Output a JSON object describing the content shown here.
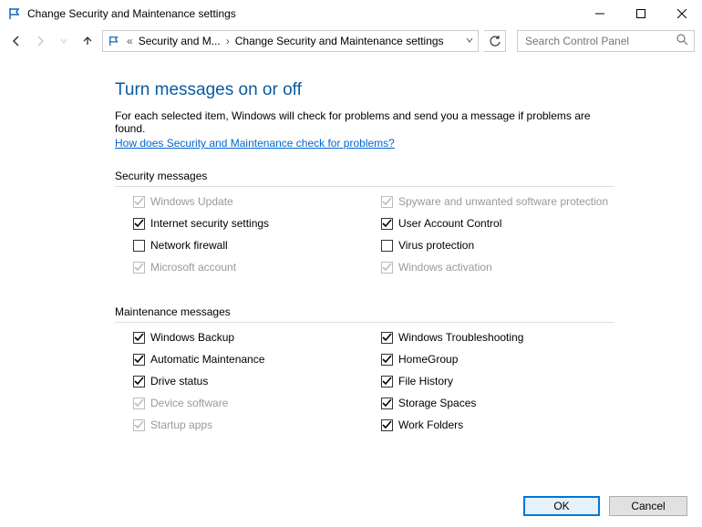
{
  "window": {
    "title": "Change Security and Maintenance settings"
  },
  "breadcrumb": {
    "item1": "Security and M...",
    "item2": "Change Security and Maintenance settings"
  },
  "search": {
    "placeholder": "Search Control Panel"
  },
  "page": {
    "title": "Turn messages on or off",
    "desc": "For each selected item, Windows will check for problems and send you a message if problems are found.",
    "help": "How does Security and Maintenance check for problems?"
  },
  "sections": {
    "security_head": "Security messages",
    "maintenance_head": "Maintenance messages"
  },
  "security": [
    {
      "label": "Windows Update",
      "checked": true,
      "disabled": true
    },
    {
      "label": "Spyware and unwanted software protection",
      "checked": true,
      "disabled": true
    },
    {
      "label": "Internet security settings",
      "checked": true,
      "disabled": false
    },
    {
      "label": "User Account Control",
      "checked": true,
      "disabled": false
    },
    {
      "label": "Network firewall",
      "checked": false,
      "disabled": false
    },
    {
      "label": "Virus protection",
      "checked": false,
      "disabled": false
    },
    {
      "label": "Microsoft account",
      "checked": true,
      "disabled": true
    },
    {
      "label": "Windows activation",
      "checked": true,
      "disabled": true
    }
  ],
  "maintenance": [
    {
      "label": "Windows Backup",
      "checked": true,
      "disabled": false
    },
    {
      "label": "Windows Troubleshooting",
      "checked": true,
      "disabled": false
    },
    {
      "label": "Automatic Maintenance",
      "checked": true,
      "disabled": false
    },
    {
      "label": "HomeGroup",
      "checked": true,
      "disabled": false
    },
    {
      "label": "Drive status",
      "checked": true,
      "disabled": false
    },
    {
      "label": "File History",
      "checked": true,
      "disabled": false
    },
    {
      "label": "Device software",
      "checked": true,
      "disabled": true
    },
    {
      "label": "Storage Spaces",
      "checked": true,
      "disabled": false
    },
    {
      "label": "Startup apps",
      "checked": true,
      "disabled": true
    },
    {
      "label": "Work Folders",
      "checked": true,
      "disabled": false
    }
  ],
  "buttons": {
    "ok": "OK",
    "cancel": "Cancel"
  }
}
